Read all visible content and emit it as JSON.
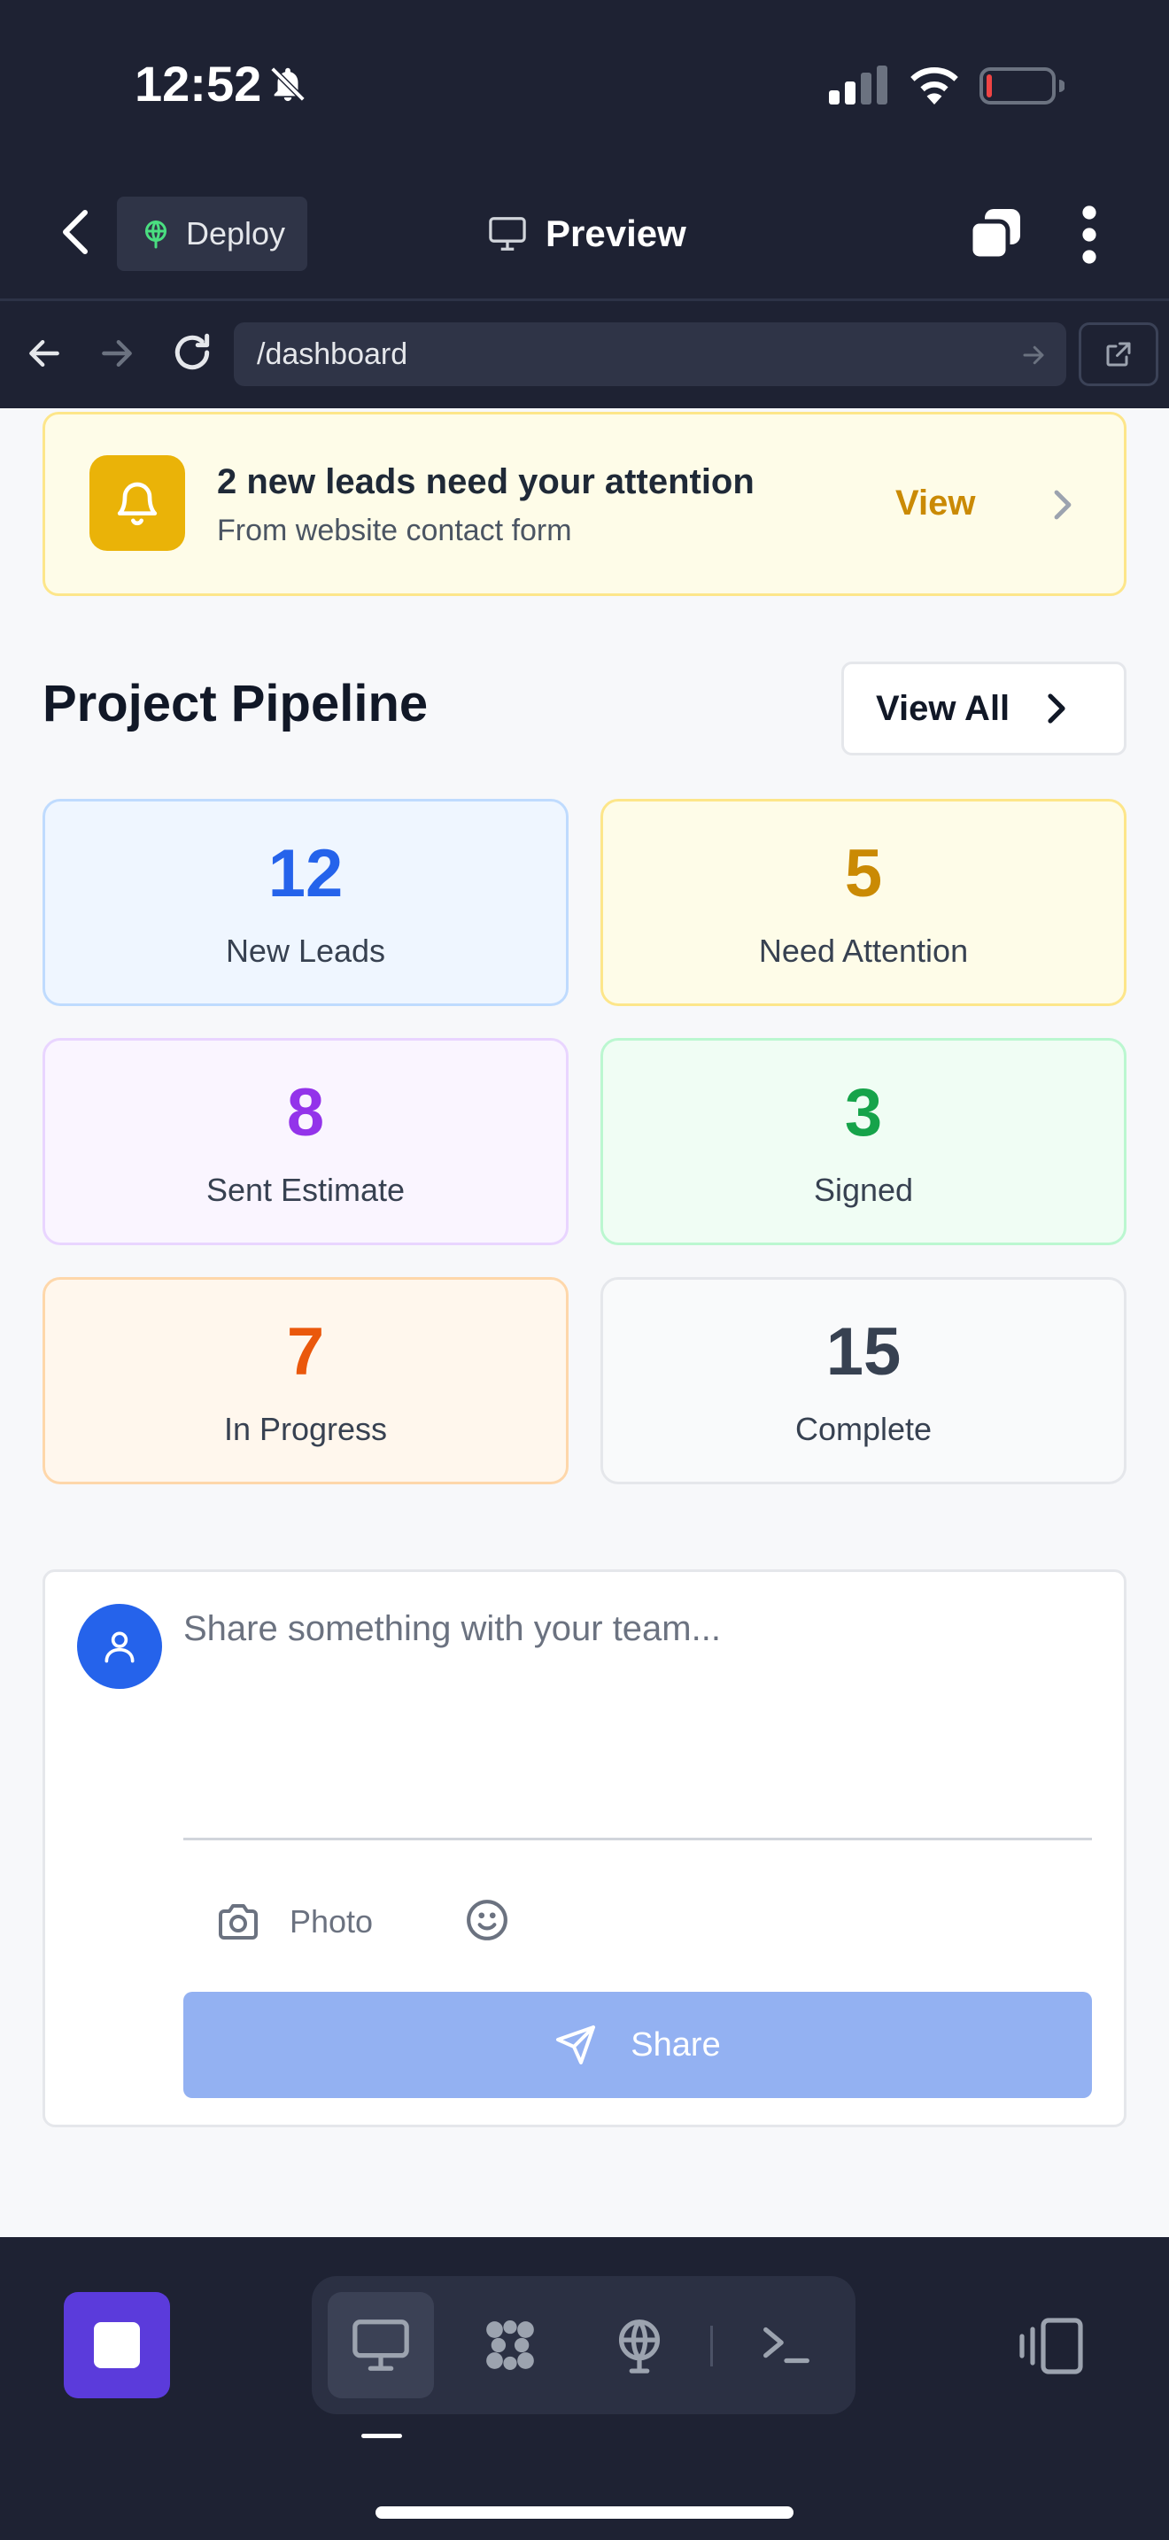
{
  "status_bar": {
    "time": "12:52"
  },
  "nav": {
    "deploy_label": "Deploy",
    "title": "Preview"
  },
  "url_bar": {
    "url": "/dashboard"
  },
  "alert": {
    "title": "2 new leads need your attention",
    "subtitle": "From website contact form",
    "action": "View"
  },
  "pipeline": {
    "title": "Project Pipeline",
    "view_all": "View All",
    "stats": [
      {
        "value": "12",
        "label": "New Leads",
        "color": "#2563eb",
        "bg": "#eff6ff",
        "border": "#bfdbfe"
      },
      {
        "value": "5",
        "label": "Need Attention",
        "color": "#ca8a04",
        "bg": "#fefce8",
        "border": "#fde68a"
      },
      {
        "value": "8",
        "label": "Sent Estimate",
        "color": "#9333ea",
        "bg": "#faf5ff",
        "border": "#e9d5ff"
      },
      {
        "value": "3",
        "label": "Signed",
        "color": "#16a34a",
        "bg": "#f0fdf4",
        "border": "#bbf7d0"
      },
      {
        "value": "7",
        "label": "In Progress",
        "color": "#ea580c",
        "bg": "#fff7ed",
        "border": "#fed7aa"
      },
      {
        "value": "15",
        "label": "Complete",
        "color": "#374151",
        "bg": "#f9fafb",
        "border": "#e5e7eb"
      }
    ]
  },
  "composer": {
    "placeholder": "Share something with your team...",
    "photo_label": "Photo",
    "share_label": "Share"
  },
  "colors": {
    "dark_bg": "#1e2233",
    "accent_purple": "#5b3bdb",
    "primary_blue": "#2563eb",
    "share_disabled": "#93b1f2"
  },
  "icons": [
    "bell-off-icon",
    "signal-icon",
    "wifi-icon",
    "battery-icon",
    "back-icon",
    "deploy-icon",
    "monitor-icon",
    "tabs-icon",
    "more-icon",
    "arrow-left-icon",
    "arrow-right-icon",
    "reload-icon",
    "external-link-icon",
    "bell-icon",
    "chevron-right-icon",
    "user-icon",
    "camera-icon",
    "emoji-icon",
    "send-icon",
    "stop-icon",
    "desktop-icon",
    "agents-icon",
    "globe-icon",
    "terminal-icon",
    "panel-icon"
  ]
}
